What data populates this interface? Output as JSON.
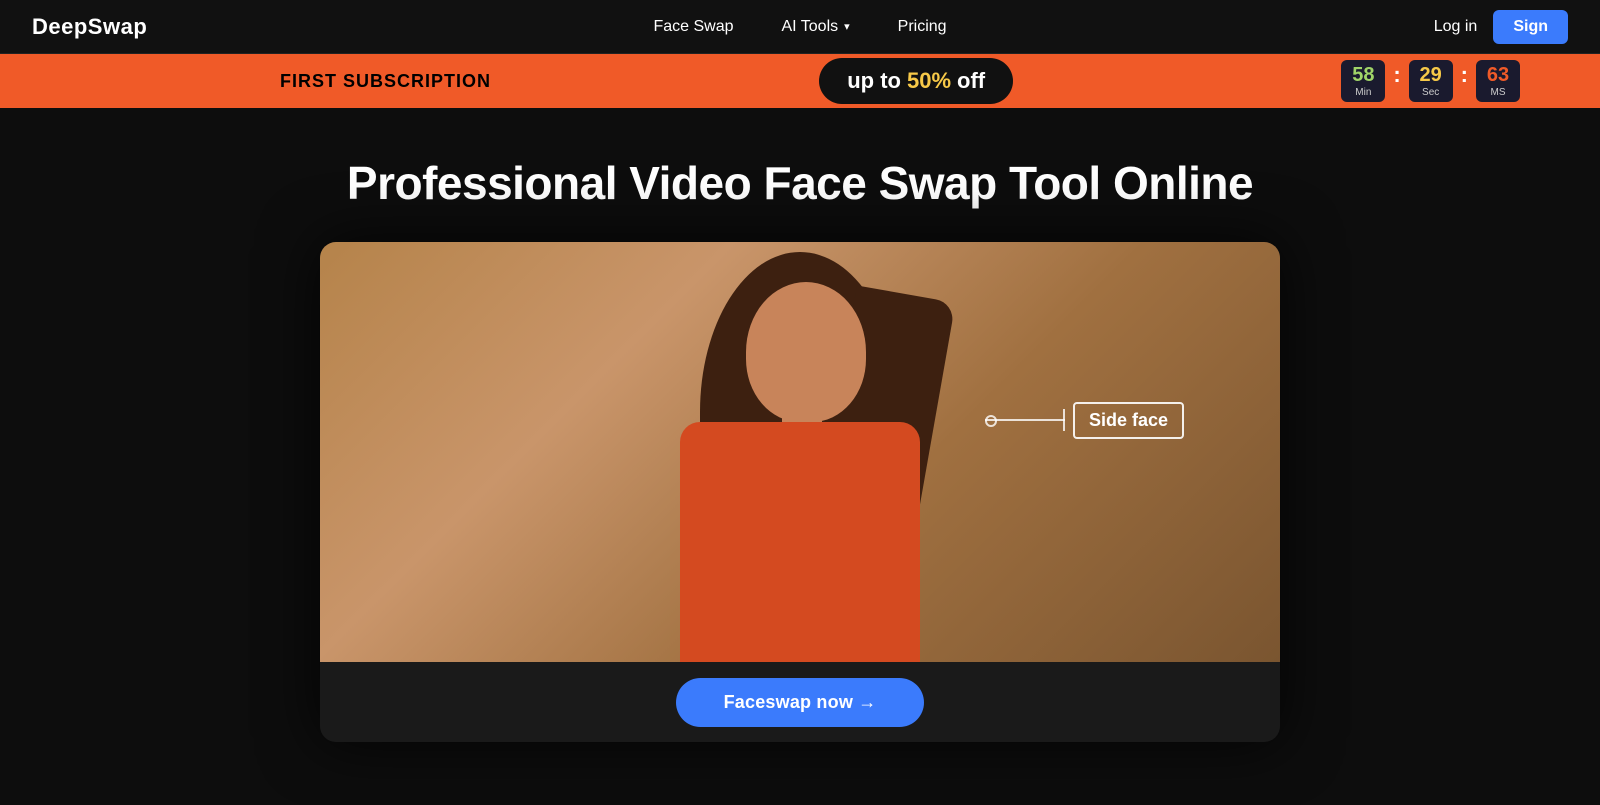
{
  "navbar": {
    "logo": "DeepSwap",
    "nav_items": [
      {
        "id": "face-swap",
        "label": "Face Swap"
      },
      {
        "id": "ai-tools",
        "label": "AI Tools",
        "has_dropdown": true
      },
      {
        "id": "pricing",
        "label": "Pricing"
      }
    ],
    "login_label": "Log in",
    "signup_label": "Sign"
  },
  "promo": {
    "left_text": "FIRST SUBSCRIPTION",
    "center_text_up_to": "up to",
    "center_text_percent": "50%",
    "center_text_off": "off",
    "timer": {
      "min_value": "58",
      "min_label": "Min",
      "sec_value": "29",
      "sec_label": "Sec",
      "ms_value": "63",
      "ms_label": "MS"
    }
  },
  "hero": {
    "title": "Professional Video Face Swap Tool Online",
    "video_label": "Side face",
    "cta_button": "Faceswap now →"
  }
}
